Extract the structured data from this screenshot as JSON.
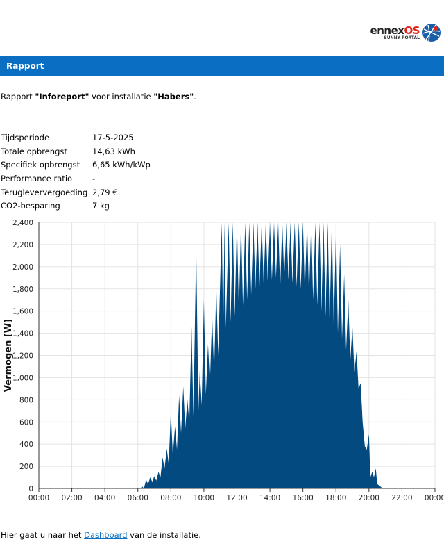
{
  "logo": {
    "brand_main": "ennex",
    "brand_accent": "OS",
    "brand_sub": "SUNNY PORTAL"
  },
  "banner": {
    "title": "Rapport"
  },
  "intro": {
    "prefix": "Rapport ",
    "report_name": "\"Inforeport\"",
    "middle": " voor installatie ",
    "installation": "\"Habers\"",
    "suffix": "."
  },
  "info": [
    {
      "label": "Tijdsperiode",
      "value": "17-5-2025"
    },
    {
      "label": "Totale opbrengst",
      "value": "14,63 kWh"
    },
    {
      "label": "Specifiek opbrengst",
      "value": "6,65 kWh/kWp"
    },
    {
      "label": "Performance ratio",
      "value": "-"
    },
    {
      "label": "Terugleververgoeding",
      "value": "2,79 €"
    },
    {
      "label": "CO2-besparing",
      "value": "7 kg"
    }
  ],
  "footer": {
    "prefix": "Hier gaat u naar het ",
    "link": "Dashboard",
    "suffix": " van de installatie."
  },
  "chart_data": {
    "type": "area",
    "ylabel": "Vermogen [W]",
    "xlabel": "",
    "color": "#034a80",
    "ylim": [
      0,
      2400
    ],
    "yticks": [
      "0",
      "200",
      "400",
      "600",
      "800",
      "1,000",
      "1,200",
      "1,400",
      "1,600",
      "1,800",
      "2,000",
      "2,200",
      "2,400"
    ],
    "xticks": [
      "00:00",
      "02:00",
      "04:00",
      "06:00",
      "08:00",
      "10:00",
      "12:00",
      "14:00",
      "16:00",
      "18:00",
      "20:00",
      "22:00",
      "00:00"
    ],
    "grid": true,
    "points": [
      [
        "00:00",
        0
      ],
      [
        "06:10",
        0
      ],
      [
        "06:15",
        20
      ],
      [
        "06:22",
        0
      ],
      [
        "06:30",
        80
      ],
      [
        "06:37",
        40
      ],
      [
        "06:45",
        100
      ],
      [
        "06:52",
        60
      ],
      [
        "07:00",
        110
      ],
      [
        "07:07",
        70
      ],
      [
        "07:15",
        150
      ],
      [
        "07:22",
        100
      ],
      [
        "07:30",
        280
      ],
      [
        "07:37",
        180
      ],
      [
        "07:45",
        360
      ],
      [
        "07:52",
        220
      ],
      [
        "08:00",
        700
      ],
      [
        "08:07",
        300
      ],
      [
        "08:15",
        560
      ],
      [
        "08:22",
        350
      ],
      [
        "08:30",
        840
      ],
      [
        "08:37",
        500
      ],
      [
        "08:45",
        920
      ],
      [
        "08:52",
        540
      ],
      [
        "09:00",
        800
      ],
      [
        "09:07",
        600
      ],
      [
        "09:15",
        1460
      ],
      [
        "09:22",
        650
      ],
      [
        "09:32",
        2180
      ],
      [
        "09:40",
        700
      ],
      [
        "09:45",
        1070
      ],
      [
        "09:52",
        750
      ],
      [
        "10:00",
        1700
      ],
      [
        "10:07",
        850
      ],
      [
        "10:15",
        1300
      ],
      [
        "10:22",
        950
      ],
      [
        "10:30",
        1560
      ],
      [
        "10:37",
        1050
      ],
      [
        "10:45",
        1820
      ],
      [
        "10:52",
        1200
      ],
      [
        "11:05",
        2400
      ],
      [
        "11:10",
        1400
      ],
      [
        "11:15",
        2400
      ],
      [
        "11:20",
        1450
      ],
      [
        "11:30",
        2400
      ],
      [
        "11:37",
        1500
      ],
      [
        "11:45",
        2400
      ],
      [
        "11:52",
        1550
      ],
      [
        "12:00",
        2400
      ],
      [
        "12:07",
        1600
      ],
      [
        "12:15",
        2400
      ],
      [
        "12:22",
        1650
      ],
      [
        "12:30",
        2400
      ],
      [
        "12:37",
        1700
      ],
      [
        "12:45",
        2400
      ],
      [
        "12:52",
        1750
      ],
      [
        "13:00",
        2400
      ],
      [
        "13:07",
        1800
      ],
      [
        "13:15",
        2400
      ],
      [
        "13:22",
        1820
      ],
      [
        "13:30",
        2400
      ],
      [
        "13:37",
        1850
      ],
      [
        "13:45",
        2400
      ],
      [
        "13:52",
        1870
      ],
      [
        "14:00",
        2400
      ],
      [
        "14:07",
        1880
      ],
      [
        "14:15",
        2400
      ],
      [
        "14:22",
        1900
      ],
      [
        "14:30",
        2400
      ],
      [
        "14:37",
        1800
      ],
      [
        "14:45",
        2400
      ],
      [
        "14:52",
        1900
      ],
      [
        "15:00",
        2400
      ],
      [
        "15:07",
        1880
      ],
      [
        "15:15",
        2400
      ],
      [
        "15:22",
        1850
      ],
      [
        "15:30",
        2400
      ],
      [
        "15:37",
        1820
      ],
      [
        "15:45",
        2400
      ],
      [
        "15:52",
        1800
      ],
      [
        "16:00",
        2400
      ],
      [
        "16:07",
        1770
      ],
      [
        "16:15",
        2400
      ],
      [
        "16:22",
        1740
      ],
      [
        "16:30",
        2400
      ],
      [
        "16:37",
        1700
      ],
      [
        "16:45",
        2400
      ],
      [
        "16:52",
        1650
      ],
      [
        "17:00",
        2400
      ],
      [
        "17:07",
        1600
      ],
      [
        "17:15",
        2400
      ],
      [
        "17:22",
        1550
      ],
      [
        "17:30",
        2400
      ],
      [
        "17:37",
        1500
      ],
      [
        "17:45",
        2400
      ],
      [
        "17:52",
        1450
      ],
      [
        "18:00",
        2350
      ],
      [
        "18:07",
        1400
      ],
      [
        "18:15",
        2200
      ],
      [
        "18:22",
        1350
      ],
      [
        "18:30",
        1930
      ],
      [
        "18:37",
        1250
      ],
      [
        "18:45",
        1700
      ],
      [
        "18:52",
        1150
      ],
      [
        "19:00",
        1460
      ],
      [
        "19:07",
        1050
      ],
      [
        "19:15",
        1240
      ],
      [
        "19:22",
        900
      ],
      [
        "19:30",
        950
      ],
      [
        "19:37",
        600
      ],
      [
        "19:45",
        380
      ],
      [
        "19:52",
        350
      ],
      [
        "20:00",
        490
      ],
      [
        "20:05",
        100
      ],
      [
        "20:12",
        150
      ],
      [
        "20:18",
        100
      ],
      [
        "20:25",
        180
      ],
      [
        "20:30",
        40
      ],
      [
        "20:40",
        20
      ],
      [
        "20:50",
        0
      ],
      [
        "24:00",
        0
      ]
    ]
  }
}
